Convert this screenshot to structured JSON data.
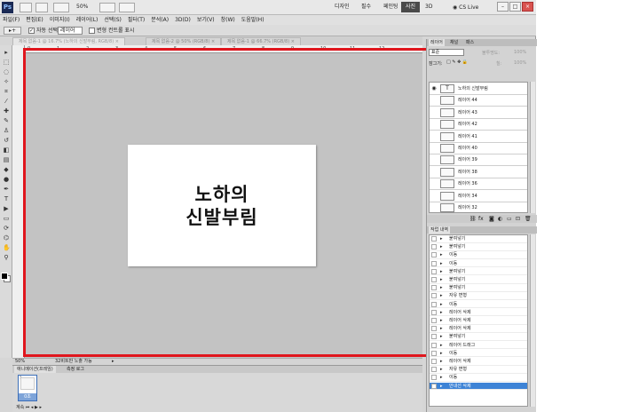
{
  "appbar": {
    "logo": "Ps",
    "zoom": "50%",
    "workspaces": [
      {
        "label": "디자인",
        "active": false
      },
      {
        "label": "필수",
        "active": false
      },
      {
        "label": "페인팅",
        "active": false
      },
      {
        "label": "사진",
        "active": true
      },
      {
        "label": "3D",
        "active": false
      }
    ],
    "cs_live": "CS Live",
    "win_min": "–",
    "win_max": "□",
    "win_close": "×"
  },
  "menu": [
    "파일(F)",
    "편집(E)",
    "이미지(I)",
    "레이어(L)",
    "선택(S)",
    "필터(T)",
    "분석(A)",
    "3D(D)",
    "보기(V)",
    "창(W)",
    "도움말(H)"
  ],
  "options": {
    "auto_select_label": "자동 선택:",
    "auto_select_value": "레이어",
    "transform_controls_label": "변형 컨트롤 표시"
  },
  "tabs": [
    {
      "label": "제목 없음-1 @ 16.7% (노하의 신발부림, RGB/8) ×"
    },
    {
      "label": "제목 없음-2 @ 50% (RGB/8) ×"
    },
    {
      "label": "제목 없음-1 @ 66.7% (RGB/8) ×"
    }
  ],
  "ruler_h": [
    "0",
    "1",
    "2",
    "3",
    "4",
    "5",
    "6",
    "7",
    "8",
    "9",
    "10",
    "11",
    "12"
  ],
  "canvas": {
    "line1": "노하의",
    "line2": "신발부림"
  },
  "status": {
    "zoom": "50%",
    "info": "32비트만 노출 가능"
  },
  "animation": {
    "tabs": [
      "애니메이션(프레임)",
      "측정 로그"
    ],
    "frame_number": "1",
    "frame_duration": "0초",
    "loop": "계속"
  },
  "layers_panel": {
    "tabs": [
      "레이어",
      "채널",
      "패스"
    ],
    "blend_mode": "표준",
    "opacity_label": "불투명도:",
    "opacity_value": "100%",
    "lock_label": "잠그기:",
    "fill_label": "칠:",
    "fill_value": "100%",
    "layers": [
      {
        "name": "노하의 신발부림",
        "thumb": "T",
        "visible": true
      },
      {
        "name": "레이어 44",
        "thumb": "",
        "visible": false
      },
      {
        "name": "레이어 43",
        "thumb": "",
        "visible": false
      },
      {
        "name": "레이어 42",
        "thumb": "",
        "visible": false
      },
      {
        "name": "레이어 41",
        "thumb": "",
        "visible": false
      },
      {
        "name": "레이어 40",
        "thumb": "",
        "visible": false
      },
      {
        "name": "레이어 39",
        "thumb": "",
        "visible": false
      },
      {
        "name": "레이어 38",
        "thumb": "",
        "visible": false
      },
      {
        "name": "레이어 36",
        "thumb": "",
        "visible": false
      },
      {
        "name": "레이어 34",
        "thumb": "",
        "visible": false
      },
      {
        "name": "레이어 32",
        "thumb": "",
        "visible": false
      }
    ]
  },
  "history_panel": {
    "tabs": [
      "작업 내역"
    ],
    "items": [
      {
        "name": "붙여넣기",
        "selected": false
      },
      {
        "name": "붙여넣기",
        "selected": false
      },
      {
        "name": "이동",
        "selected": false
      },
      {
        "name": "이동",
        "selected": false
      },
      {
        "name": "붙여넣기",
        "selected": false
      },
      {
        "name": "붙여넣기",
        "selected": false
      },
      {
        "name": "붙여넣기",
        "selected": false
      },
      {
        "name": "자유 변형",
        "selected": false
      },
      {
        "name": "이동",
        "selected": false
      },
      {
        "name": "레이어 삭제",
        "selected": false
      },
      {
        "name": "레이어 삭제",
        "selected": false
      },
      {
        "name": "레이어 삭제",
        "selected": false
      },
      {
        "name": "붙여넣기",
        "selected": false
      },
      {
        "name": "레이어 드래그",
        "selected": false
      },
      {
        "name": "이동",
        "selected": false
      },
      {
        "name": "레이어 삭제",
        "selected": false
      },
      {
        "name": "자유 변형",
        "selected": false
      },
      {
        "name": "이동",
        "selected": false
      },
      {
        "name": "안내선 삭제",
        "selected": true
      }
    ]
  },
  "colors": {
    "highlight": "#e0161d",
    "selected": "#3d83d6"
  }
}
